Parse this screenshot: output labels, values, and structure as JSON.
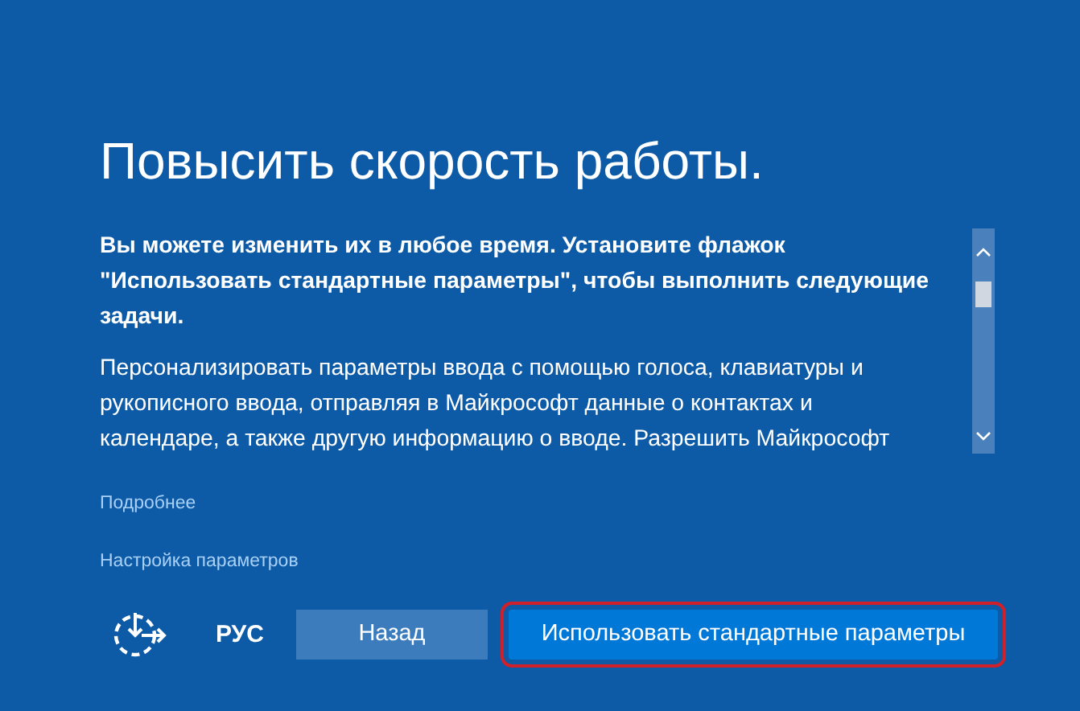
{
  "title": "Повысить скорость работы.",
  "content": {
    "paragraphs": [
      {
        "text": "Вы можете изменить их в любое время. Установите флажок \"Использовать стандартные параметры\", чтобы выполнить следующие задачи.",
        "bold": true
      },
      {
        "text": "Персонализировать параметры ввода с помощью голоса, клавиатуры и рукописного ввода, отправляя в Майкрософт данные о контактах и календаре, а также другую информацию о вводе. Разрешить Майкрософт",
        "bold": false
      }
    ]
  },
  "links": [
    "Подробнее",
    "Настройка параметров"
  ],
  "footer": {
    "language": "РУС",
    "buttons": [
      {
        "label": "Назад",
        "kind": "secondary",
        "highlighted": false
      },
      {
        "label": "Использовать стандартные параметры",
        "kind": "primary",
        "highlighted": true
      }
    ]
  }
}
